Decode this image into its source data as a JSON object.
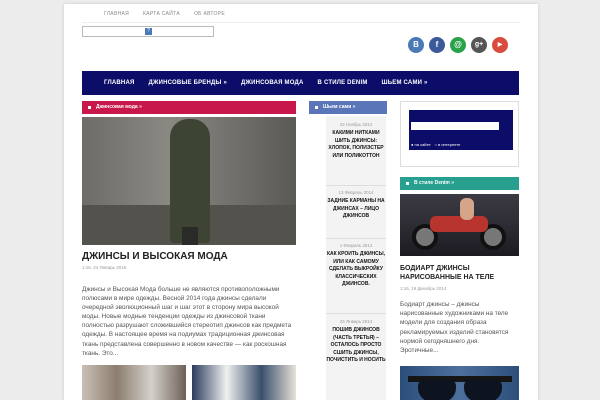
{
  "top_nav": [
    "ГЛАВНАЯ",
    "КАРТА САЙТА",
    "ОБ АВТОРЕ"
  ],
  "social": [
    {
      "icon": "vk-icon",
      "glyph": "B",
      "color": "#4a79b6"
    },
    {
      "icon": "facebook-icon",
      "glyph": "f",
      "color": "#3b5b98"
    },
    {
      "icon": "mail-icon",
      "glyph": "@",
      "color": "#2aa24a"
    },
    {
      "icon": "google-plus-icon",
      "glyph": "g+",
      "color": "#555"
    },
    {
      "icon": "youtube-icon",
      "glyph": "▶",
      "color": "#d94b3c"
    }
  ],
  "main_nav": [
    "ГЛАВНАЯ",
    "ДЖИНСОВЫЕ БРЕНДЫ »",
    "ДЖИНСОВАЯ МОДА",
    "В СТИЛЕ DENIM",
    "ШЬЕМ САМИ »"
  ],
  "section_bars": {
    "left": "Джинсовая мода »",
    "middle": "Шьем сами »",
    "right": "В стиле Denim »"
  },
  "feature": {
    "title": "ДЖИНСЫ И ВЫСОКАЯ МОДА",
    "meta": "1:16, 24 Январь 2015",
    "excerpt": "Джинсы и Высокая Мода больше не являются противоположными полюсами в мире одежды. Весной 2014 года джинсы сделали очередной эволюционный шаг и шаг этот в сторону мира высокой моды. Новые модные тенденции одежды из джинсовой ткани полностью разрушают сложившийся стереотип джинсов как предмета одежды. В настоящее время на подиумах традиционная джинсовая ткань представлена совершенно в новом качестве — как роскошная ткань. Это..."
  },
  "middle_list": [
    {
      "date": "22 Ноябрь 2014",
      "title": "КАКИМИ НИТКАМИ ШИТЬ ДЖИНСЫ: ХЛОПОК, ПОЛИЭСТЕР ИЛИ ПОЛИКОТТОН"
    },
    {
      "date": "13 Февраль 2014",
      "title": "ЗАДНИЕ КАРМАНЫ НА ДЖИНСАХ – ЛИЦО ДЖИНСОВ"
    },
    {
      "date": "1 Февраль 2014",
      "title": "КАК КРОИТЬ ДЖИНСЫ, ИЛИ КАК САМОМУ СДЕЛАТЬ ВЫКРОЙКУ КЛАССИЧЕСКИХ ДЖИНСОВ."
    },
    {
      "date": "25 Январь 2014",
      "title": "ПОШИВ ДЖИНСОВ (ЧАСТЬ ТРЕТЬЯ) – ОСТАЛОСЬ ПРОСТО СШИТЬ ДЖИНСЫ, ПОЧИСТИТЬ И НОСИТЬ"
    }
  ],
  "search_widget": {
    "radio_site": "на сайте",
    "radio_web": "в интернете"
  },
  "right_post": {
    "title": "БОДИАРТ ДЖИНСЫ НАРИСОВАННЫЕ НА ТЕЛЕ",
    "meta": "1:16, 19 Декабрь 2014",
    "excerpt": "Бодиарт джинсы – джинсы нарисованные художниками на теле модели для создания образа рекламируемых изделий становятся нормой сегодняшнего дня. Эротичные..."
  }
}
